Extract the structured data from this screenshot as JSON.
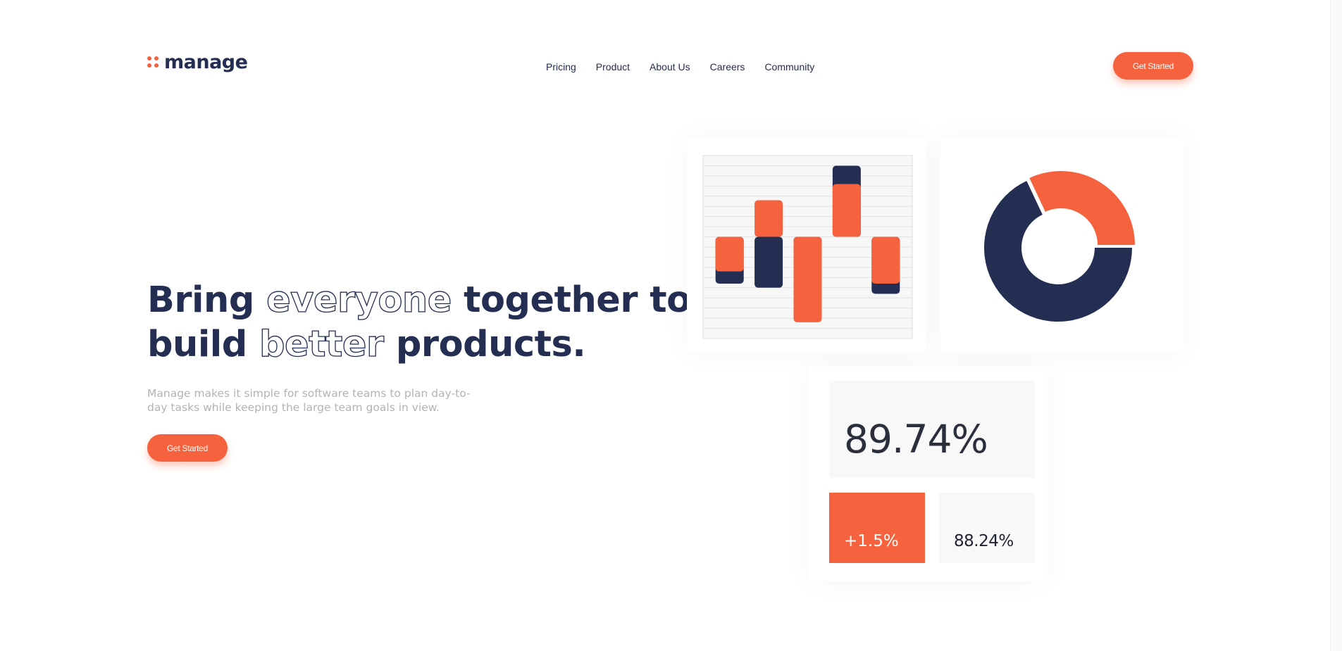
{
  "header": {
    "logo_text": "manage",
    "nav": [
      "Pricing",
      "Product",
      "About Us",
      "Careers",
      "Community"
    ],
    "cta_label": "Get Started"
  },
  "hero": {
    "title_line1": [
      "Bring ",
      "everyone",
      " together to"
    ],
    "title_line2": [
      "build ",
      "better",
      " products."
    ],
    "description": "Manage makes it simple for software teams to plan day-to-day tasks while keeping the large team goals in view.",
    "cta_label": "Get Started"
  },
  "stats": {
    "main": "89.74%",
    "change": "+1.5%",
    "secondary": "88.24%"
  },
  "colors": {
    "accent": "#f5623d",
    "navy": "#242d52",
    "text_muted": "#b3b3b3",
    "panel_bg": "#f8f8f8"
  },
  "chart_data": [
    {
      "type": "bar",
      "baseline": 0,
      "ylim": [
        -5,
        4
      ],
      "grid": true,
      "categories": [
        "",
        "",
        "",
        "",
        ""
      ],
      "series": [
        {
          "values": [
            -2.3,
            -2.5,
            -1.7,
            3.5,
            -2.8
          ],
          "color": "#242d52"
        },
        {
          "values": [
            -1.7,
            1.8,
            -4.2,
            2.6,
            -2.3
          ],
          "color": "#f5623d"
        }
      ]
    },
    {
      "type": "pie",
      "donut": true,
      "values": [
        68,
        32
      ],
      "colors": [
        "#242d52",
        "#f5623d"
      ]
    }
  ]
}
